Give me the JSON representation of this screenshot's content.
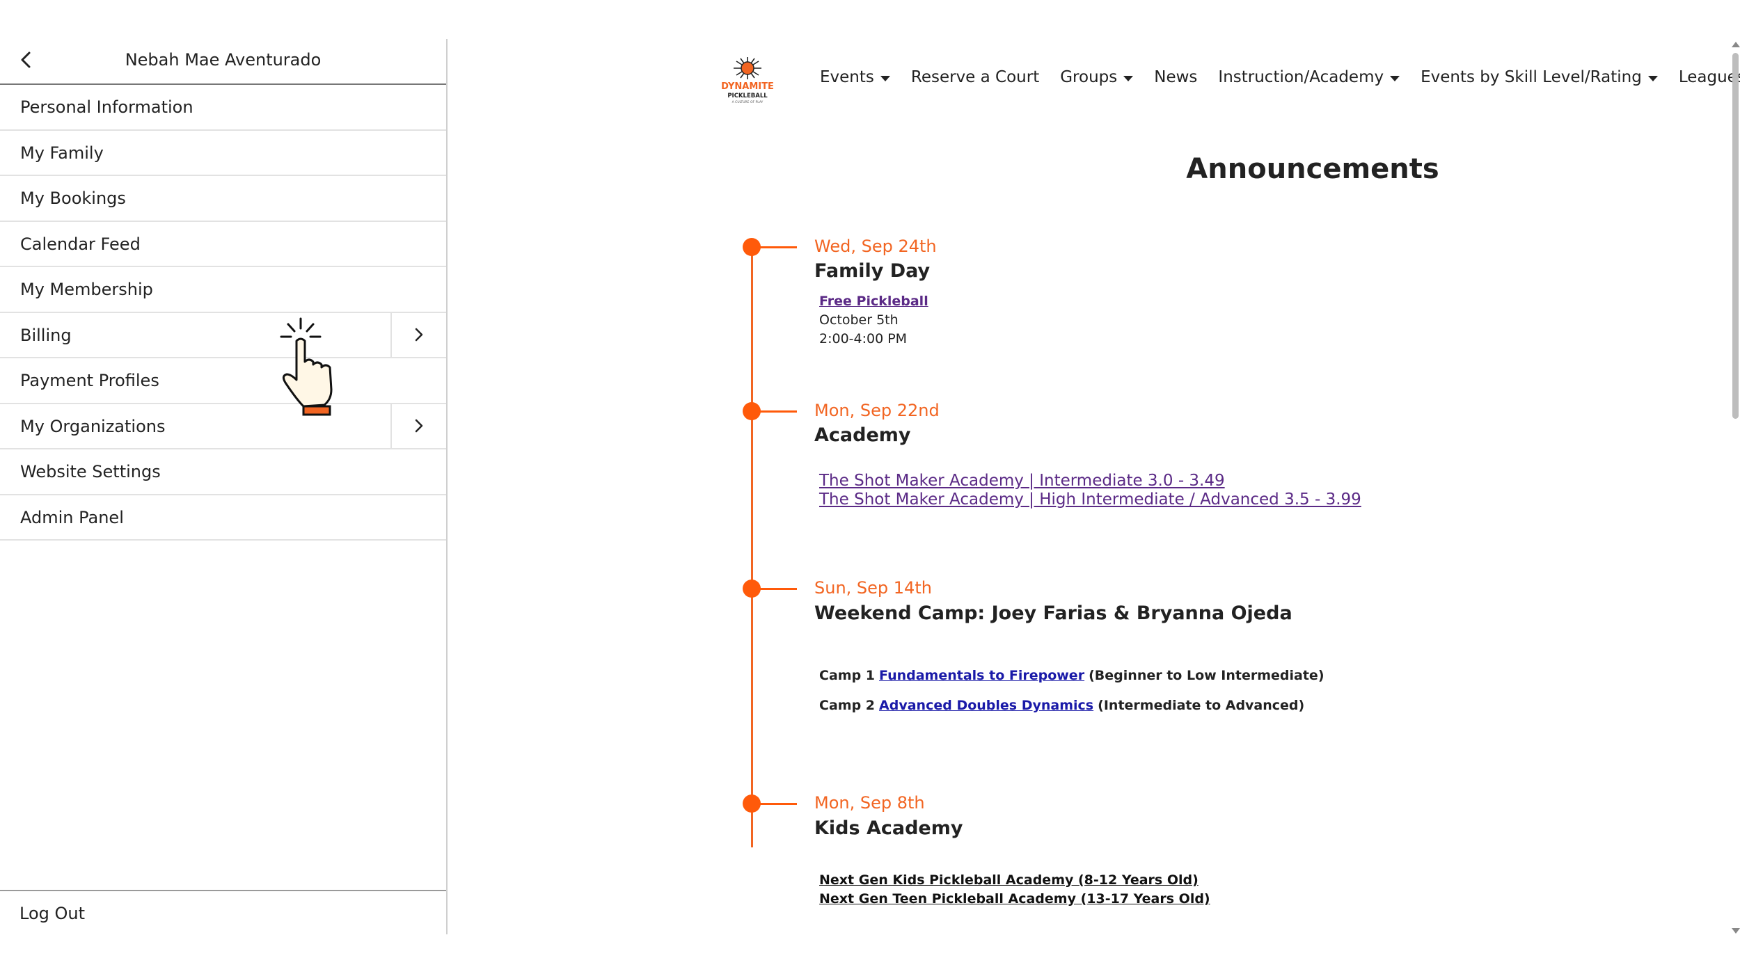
{
  "sidebar": {
    "user_name": "Nebah Mae Aventurado",
    "items": [
      {
        "label": "Personal Information"
      },
      {
        "label": "My Family"
      },
      {
        "label": "My Bookings"
      },
      {
        "label": "Calendar Feed"
      },
      {
        "label": "My Membership"
      },
      {
        "label": "Billing"
      },
      {
        "label": "Payment Profiles"
      },
      {
        "label": "My Organizations"
      },
      {
        "label": "Website Settings"
      },
      {
        "label": "Admin Panel"
      }
    ],
    "logout_label": "Log Out"
  },
  "logo": {
    "text_main": "DYNAMITE",
    "text_sub": "PICKLEBALL",
    "tagline": "A CULTURE OF PLAY"
  },
  "nav": {
    "items": [
      {
        "label": "Events"
      },
      {
        "label": "Reserve a Court"
      },
      {
        "label": "Groups"
      },
      {
        "label": "News"
      },
      {
        "label": "Instruction/Academy"
      },
      {
        "label": "Events by Skill Level/Rating"
      },
      {
        "label": "Leagues"
      }
    ]
  },
  "page": {
    "title": "Announcements"
  },
  "announcements": [
    {
      "date": "Wed, Sep 24th",
      "title": "Family Day",
      "link": "Free Pickleball",
      "line1": "October 5th",
      "line2": "2:00-4:00 PM"
    },
    {
      "date": "Mon, Sep 22nd",
      "title": "Academy",
      "link1": "The Shot Maker Academy | Intermediate 3.0 - 3.49",
      "link2": "The Shot Maker Academy | High Intermediate / Advanced 3.5 - 3.99"
    },
    {
      "date": "Sun, Sep 14th",
      "title": "Weekend Camp: Joey Farias & Bryanna Ojeda",
      "camp1_prefix": "Camp 1",
      "camp1_link": "Fundamentals to Firepower",
      "camp1_suffix": "(Beginner to Low Intermediate)",
      "camp2_prefix": "Camp 2",
      "camp2_link": "Advanced Doubles Dynamics",
      "camp2_suffix": "(Intermediate to Advanced)"
    },
    {
      "date": "Mon, Sep 8th",
      "title": "Kids Academy",
      "link1": "Next Gen Kids Pickleball Academy (8-12 Years Old)",
      "link2": "Next Gen Teen Pickleball Academy (13-17 Years Old)"
    }
  ],
  "colors": {
    "accent": "#f26522",
    "timeline_dot": "#ff5a0a",
    "link_purple": "#5b2a86",
    "link_blue": "#1a1aa8"
  }
}
